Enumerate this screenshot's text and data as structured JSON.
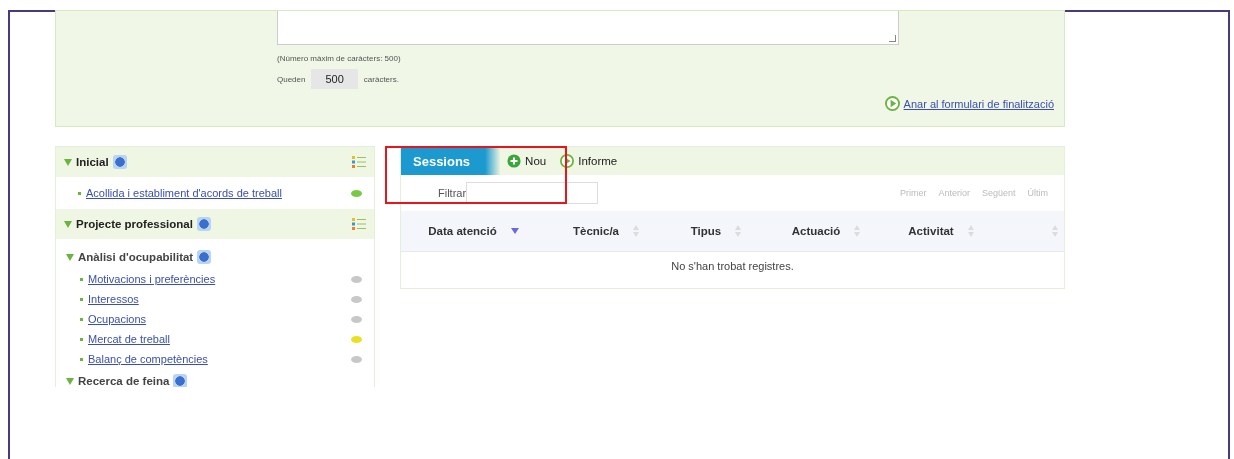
{
  "form": {
    "max_note": "(Número màxim de caràcters: 500)",
    "remaining_label": "Queden",
    "remaining": "500",
    "remaining_unit": "caràcters.",
    "finish_link": "Anar al formulari de finalització"
  },
  "sidebar": [
    {
      "title": "Inicial",
      "expanded": true,
      "children": [
        {
          "kind": "link",
          "label": "Acollida i establiment d'acords de treball",
          "color": "#7ac943"
        }
      ]
    },
    {
      "title": "Projecte professional",
      "expanded": true,
      "children": [
        {
          "kind": "group",
          "title": "Anàlisi d'ocupabilitat",
          "expanded": true,
          "children": [
            {
              "kind": "link",
              "label": "Motivacions i preferències",
              "color": "#c8c8c8"
            },
            {
              "kind": "link",
              "label": "Interessos",
              "color": "#c8c8c8"
            },
            {
              "kind": "link",
              "label": "Ocupacions",
              "color": "#c8c8c8"
            },
            {
              "kind": "link",
              "label": "Mercat de treball",
              "color": "#e8e020"
            },
            {
              "kind": "link",
              "label": "Balanç de competències",
              "color": "#c8c8c8"
            }
          ]
        },
        {
          "kind": "group",
          "title": "Recerca de feina",
          "expanded": true
        }
      ]
    }
  ],
  "sessions": {
    "title": "Sessions",
    "actions": [
      {
        "kind": "new",
        "label": "Nou"
      },
      {
        "kind": "report",
        "label": "Informe"
      }
    ],
    "filter_label": "Filtrar",
    "pager": [
      "Primer",
      "Anterior",
      "Següent",
      "Últim"
    ],
    "columns": [
      {
        "label": "Data atenció",
        "sorted": true
      },
      {
        "label": "Tècnic/a",
        "sorted": false
      },
      {
        "label": "Tipus",
        "sorted": false
      },
      {
        "label": "Actuació",
        "sorted": false
      },
      {
        "label": "Activitat",
        "sorted": false
      },
      {
        "sorted": false
      }
    ],
    "empty_message": "No s'han trobat registres."
  },
  "highlight": true
}
